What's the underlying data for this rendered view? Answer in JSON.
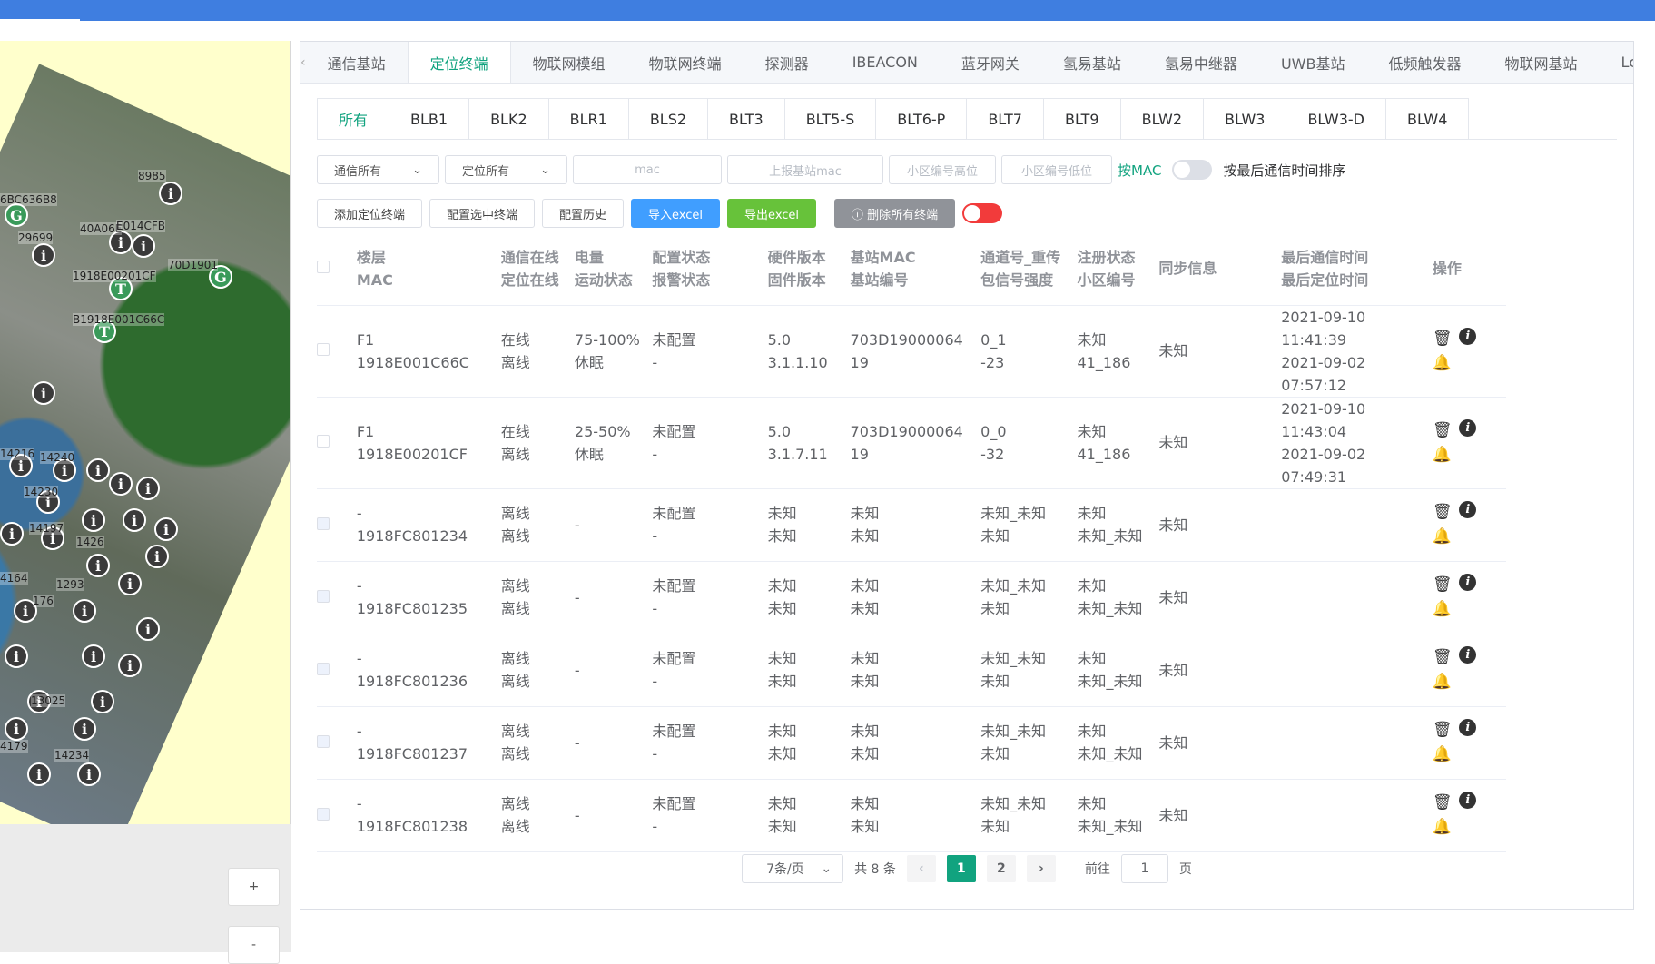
{
  "colors": {
    "accent": "#11a37f",
    "topbar": "#3f7ee0",
    "import": "#409eff",
    "export": "#67c23a",
    "danger_toggle": "#f23b3b"
  },
  "map": {
    "labels": [
      "6BC636B8",
      "8985",
      "29699",
      "40A06E",
      "E014CFB",
      "1918E00201CF",
      "70D1901",
      "B1918E001C66C",
      "14216",
      "14240",
      "14230",
      "14197",
      "1426",
      "4164",
      "176",
      "1293",
      "13025",
      "4179",
      "14234"
    ],
    "zoom_in": "+",
    "zoom_out": "-"
  },
  "tabs": {
    "prev": "‹",
    "next": "›",
    "items": [
      "通信基站",
      "定位终端",
      "物联网模组",
      "物联网终端",
      "探测器",
      "IBEACON",
      "蓝牙网关",
      "氢易基站",
      "氢易中继器",
      "UWB基站",
      "低频触发器",
      "物联网基站",
      "Lc"
    ],
    "active": 1
  },
  "subtabs": {
    "items": [
      "所有",
      "BLB1",
      "BLK2",
      "BLR1",
      "BLS2",
      "BLT3",
      "BLT5-S",
      "BLT6-P",
      "BLT7",
      "BLT9",
      "BLW2",
      "BLW3",
      "BLW3-D",
      "BLW4"
    ],
    "active": 0
  },
  "filters": {
    "comm_select": "通信所有",
    "loc_select": "定位所有",
    "mac_placeholder": "mac",
    "report_mac_placeholder": "上报基站mac",
    "cell_high_placeholder": "小区编号高位",
    "cell_low_placeholder": "小区编号低位",
    "by_mac_label": "按MAC",
    "sort_label": "按最后通信时间排序"
  },
  "actions": {
    "add": "添加定位终端",
    "config_selected": "配置选中终端",
    "config_history": "配置历史",
    "import": "导入excel",
    "export": "导出excel",
    "delete_all": "ⓘ 删除所有终端"
  },
  "table": {
    "headers": [
      [
        "楼层",
        "MAC"
      ],
      [
        "通信在线",
        "定位在线"
      ],
      [
        "电量",
        "运动状态"
      ],
      [
        "配置状态",
        "报警状态"
      ],
      [
        "硬件版本",
        "固件版本"
      ],
      [
        "基站MAC",
        "基站编号"
      ],
      [
        "通道号_重传",
        "包信号强度"
      ],
      [
        "注册状态",
        "小区编号"
      ],
      [
        "同步信息",
        ""
      ],
      [
        "最后通信时间",
        "最后定位时间"
      ],
      [
        "操作",
        ""
      ]
    ],
    "rows": [
      {
        "c": [
          [
            "F1",
            "1918E001C66C"
          ],
          [
            "在线",
            "离线"
          ],
          [
            "75-100%",
            "休眠"
          ],
          [
            "未配置",
            "-"
          ],
          [
            "5.0",
            "3.1.1.10"
          ],
          [
            "703D19000064",
            "19"
          ],
          [
            "0_1",
            "-23"
          ],
          [
            "未知",
            "41_186"
          ],
          [
            "未知",
            ""
          ],
          [
            "2021-09-10 11:41:39",
            "2021-09-02 07:57:12"
          ]
        ]
      },
      {
        "c": [
          [
            "F1",
            "1918E00201CF"
          ],
          [
            "在线",
            "离线"
          ],
          [
            "25-50%",
            "休眠"
          ],
          [
            "未配置",
            "-"
          ],
          [
            "5.0",
            "3.1.7.11"
          ],
          [
            "703D19000064",
            "19"
          ],
          [
            "0_0",
            "-32"
          ],
          [
            "未知",
            "41_186"
          ],
          [
            "未知",
            ""
          ],
          [
            "2021-09-10 11:43:04",
            "2021-09-02 07:49:31"
          ]
        ]
      },
      {
        "c": [
          [
            "-",
            "1918FC801234"
          ],
          [
            "离线",
            "离线"
          ],
          [
            "-",
            ""
          ],
          [
            "未配置",
            "-"
          ],
          [
            "未知",
            "未知"
          ],
          [
            "未知",
            "未知"
          ],
          [
            "未知_未知",
            "未知"
          ],
          [
            "未知",
            "未知_未知"
          ],
          [
            "未知",
            ""
          ],
          [
            "",
            ""
          ]
        ]
      },
      {
        "c": [
          [
            "-",
            "1918FC801235"
          ],
          [
            "离线",
            "离线"
          ],
          [
            "-",
            ""
          ],
          [
            "未配置",
            "-"
          ],
          [
            "未知",
            "未知"
          ],
          [
            "未知",
            "未知"
          ],
          [
            "未知_未知",
            "未知"
          ],
          [
            "未知",
            "未知_未知"
          ],
          [
            "未知",
            ""
          ],
          [
            "",
            ""
          ]
        ]
      },
      {
        "c": [
          [
            "-",
            "1918FC801236"
          ],
          [
            "离线",
            "离线"
          ],
          [
            "-",
            ""
          ],
          [
            "未配置",
            "-"
          ],
          [
            "未知",
            "未知"
          ],
          [
            "未知",
            "未知"
          ],
          [
            "未知_未知",
            "未知"
          ],
          [
            "未知",
            "未知_未知"
          ],
          [
            "未知",
            ""
          ],
          [
            "",
            ""
          ]
        ]
      },
      {
        "c": [
          [
            "-",
            "1918FC801237"
          ],
          [
            "离线",
            "离线"
          ],
          [
            "-",
            ""
          ],
          [
            "未配置",
            "-"
          ],
          [
            "未知",
            "未知"
          ],
          [
            "未知",
            "未知"
          ],
          [
            "未知_未知",
            "未知"
          ],
          [
            "未知",
            "未知_未知"
          ],
          [
            "未知",
            ""
          ],
          [
            "",
            ""
          ]
        ]
      },
      {
        "c": [
          [
            "-",
            "1918FC801238"
          ],
          [
            "离线",
            "离线"
          ],
          [
            "-",
            ""
          ],
          [
            "未配置",
            "-"
          ],
          [
            "未知",
            "未知"
          ],
          [
            "未知",
            "未知"
          ],
          [
            "未知_未知",
            "未知"
          ],
          [
            "未知",
            "未知_未知"
          ],
          [
            "未知",
            ""
          ],
          [
            "",
            ""
          ]
        ]
      }
    ]
  },
  "pager": {
    "size": "7条/页",
    "total": "共 8 条",
    "prev": "‹",
    "pages": [
      "1",
      "2"
    ],
    "active": "1",
    "next": "›",
    "goto_label": "前往",
    "goto_value": "1",
    "goto_suffix": "页"
  }
}
